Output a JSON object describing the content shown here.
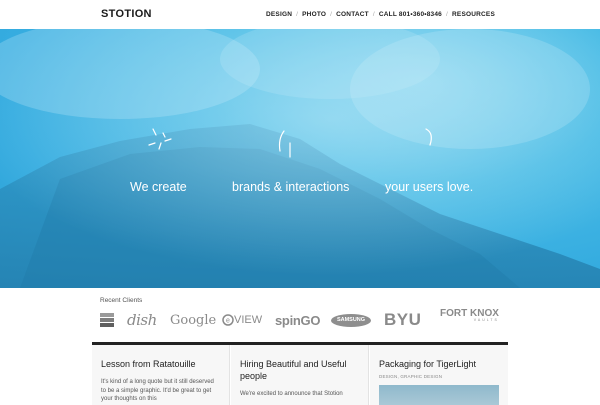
{
  "header": {
    "logo": "STOTION",
    "nav": [
      "DESIGN",
      "PHOTO",
      "CONTACT",
      "CALL 801•360•8346",
      "RESOURCES"
    ],
    "nav_separator": "/"
  },
  "hero": {
    "tagline_1": "We create",
    "tagline_2": "brands & interactions",
    "tagline_3": "your users love.",
    "background_color": "#3fb4e2"
  },
  "clients": {
    "label": "Recent Clients",
    "logos": [
      "dish",
      "Google",
      "VIEW",
      "spinGO",
      "SAMSUNG",
      "BYU",
      "FORT KNOX",
      "VAULTS"
    ]
  },
  "posts": [
    {
      "title": "Lesson from Ratatouille",
      "excerpt": "It's kind of a long quote but it still deserved to be a simple graphic. It'd be great to get your thoughts on this"
    },
    {
      "title": "Hiring Beautiful and Useful people",
      "excerpt": "We're excited to announce that Stotion"
    },
    {
      "title": "Packaging for TigerLight",
      "meta": "DESIGN, GRAPHIC DESIGN"
    }
  ]
}
